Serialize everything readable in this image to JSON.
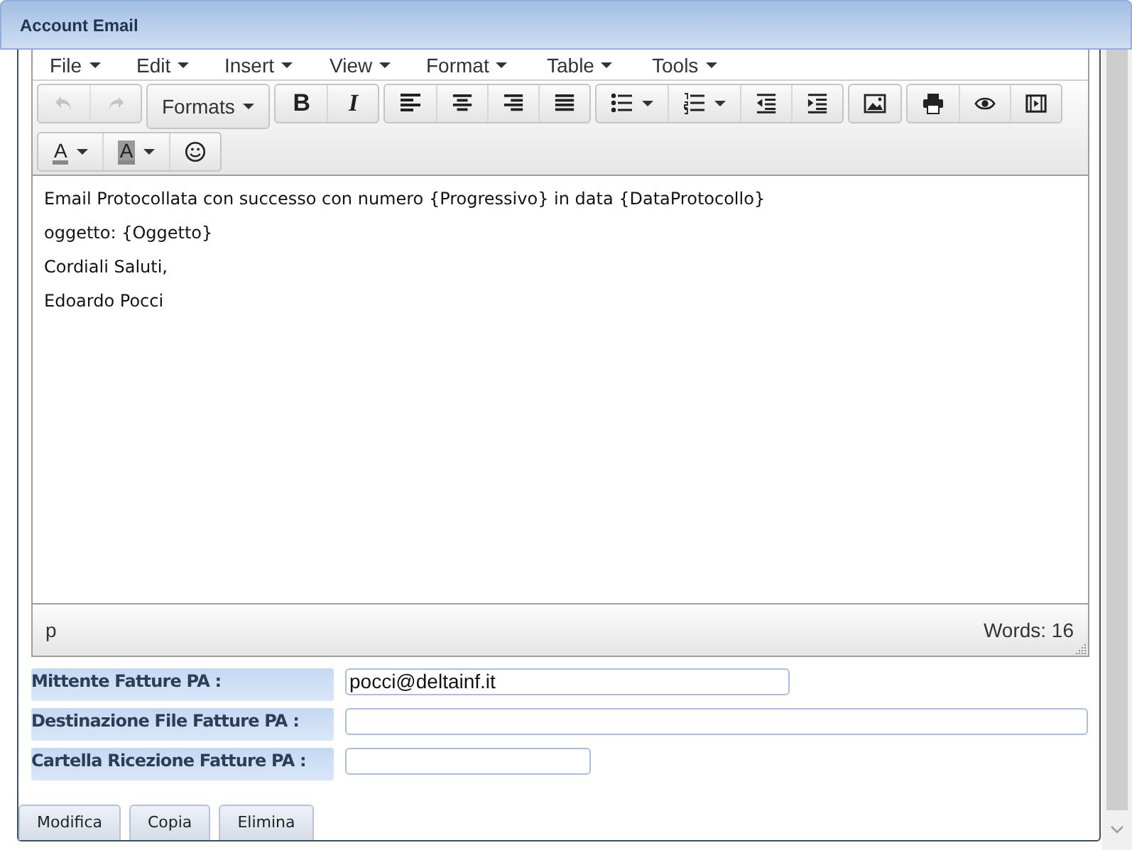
{
  "window": {
    "title": "Account Email"
  },
  "editor": {
    "menu": [
      {
        "label": "File"
      },
      {
        "label": "Edit"
      },
      {
        "label": "Insert"
      },
      {
        "label": "View"
      },
      {
        "label": "Format"
      },
      {
        "label": "Table"
      },
      {
        "label": "Tools"
      }
    ],
    "toolbar": [
      [
        [
          {
            "kind": "undo",
            "disabled": true
          },
          {
            "kind": "redo",
            "disabled": true
          }
        ],
        [
          {
            "kind": "formats",
            "label": "Formats",
            "disabled": false
          }
        ],
        [
          {
            "kind": "bold",
            "label": "B",
            "disabled": false
          },
          {
            "kind": "italic",
            "label": "I",
            "disabled": false
          }
        ],
        [
          {
            "kind": "align-left",
            "disabled": false
          },
          {
            "kind": "align-center",
            "disabled": false
          },
          {
            "kind": "align-right",
            "disabled": false
          },
          {
            "kind": "justify",
            "disabled": false
          }
        ],
        [
          {
            "kind": "bullet-list",
            "disabled": false
          },
          {
            "kind": "numbered-list",
            "disabled": false
          },
          {
            "kind": "outdent",
            "disabled": false
          },
          {
            "kind": "indent",
            "disabled": false
          }
        ],
        [
          {
            "kind": "image",
            "disabled": false
          }
        ],
        [
          {
            "kind": "print",
            "disabled": false
          },
          {
            "kind": "preview",
            "disabled": false
          },
          {
            "kind": "media",
            "disabled": false
          }
        ]
      ],
      [
        [
          {
            "kind": "text-color",
            "label": "A",
            "disabled": false
          },
          {
            "kind": "background-color",
            "label": "A",
            "disabled": false
          },
          {
            "kind": "emoticon",
            "disabled": false
          }
        ]
      ]
    ],
    "paragraphs": [
      "Email Protocollata con successo con numero {Progressivo} in data {DataProtocollo}",
      "oggetto: {Oggetto}",
      "Cordiali Saluti,",
      "Edoardo Pocci"
    ],
    "status_bar": {
      "path": "p",
      "word_count": "Words: 16"
    }
  },
  "form": [
    {
      "label": "Mittente Fatture PA :",
      "value": "pocci@deltainf.it"
    },
    {
      "label": "Destinazione File Fatture PA :"
    },
    {
      "label": "Cartella Ricezione Fatture PA :"
    }
  ],
  "buttons": [
    {
      "label": "Modifica"
    },
    {
      "label": "Copia"
    },
    {
      "label": "Elimina"
    }
  ]
}
